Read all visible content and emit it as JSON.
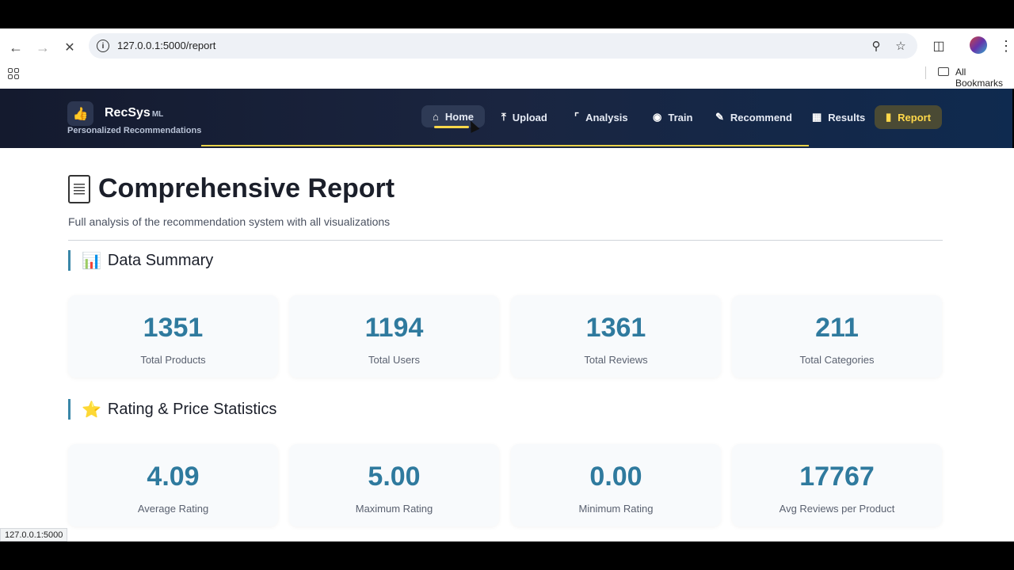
{
  "browser": {
    "url": "127.0.0.1:5000/report",
    "bookmarks_label": "All Bookmarks",
    "status_url": "127.0.0.1:5000"
  },
  "app": {
    "brand": "RecSys",
    "brand_suffix": "ML",
    "tagline": "Personalized Recommendations",
    "nav": [
      {
        "label": "Home",
        "icon": "home-icon",
        "state": "hover"
      },
      {
        "label": "Upload",
        "icon": "upload-icon"
      },
      {
        "label": "Analysis",
        "icon": "chart-icon"
      },
      {
        "label": "Train",
        "icon": "brain-icon"
      },
      {
        "label": "Recommend",
        "icon": "pencil-icon"
      },
      {
        "label": "Results",
        "icon": "table-icon"
      },
      {
        "label": "Report",
        "icon": "document-icon",
        "state": "active"
      }
    ],
    "accent": "#ffd84a"
  },
  "page": {
    "title": "Comprehensive Report",
    "subtitle": "Full analysis of the recommendation system with all visualizations",
    "sections": [
      {
        "title": "Data Summary",
        "icon": "bar-chart-icon",
        "cards": [
          {
            "value": "1351",
            "label": "Total Products"
          },
          {
            "value": "1194",
            "label": "Total Users"
          },
          {
            "value": "1361",
            "label": "Total Reviews"
          },
          {
            "value": "211",
            "label": "Total Categories"
          }
        ]
      },
      {
        "title": "Rating & Price Statistics",
        "icon": "star-icon",
        "cards": [
          {
            "value": "4.09",
            "label": "Average Rating"
          },
          {
            "value": "5.00",
            "label": "Maximum Rating"
          },
          {
            "value": "0.00",
            "label": "Minimum Rating"
          },
          {
            "value": "17767",
            "label": "Avg Reviews per Product"
          }
        ]
      }
    ],
    "value_color": "#2f7a9e"
  }
}
